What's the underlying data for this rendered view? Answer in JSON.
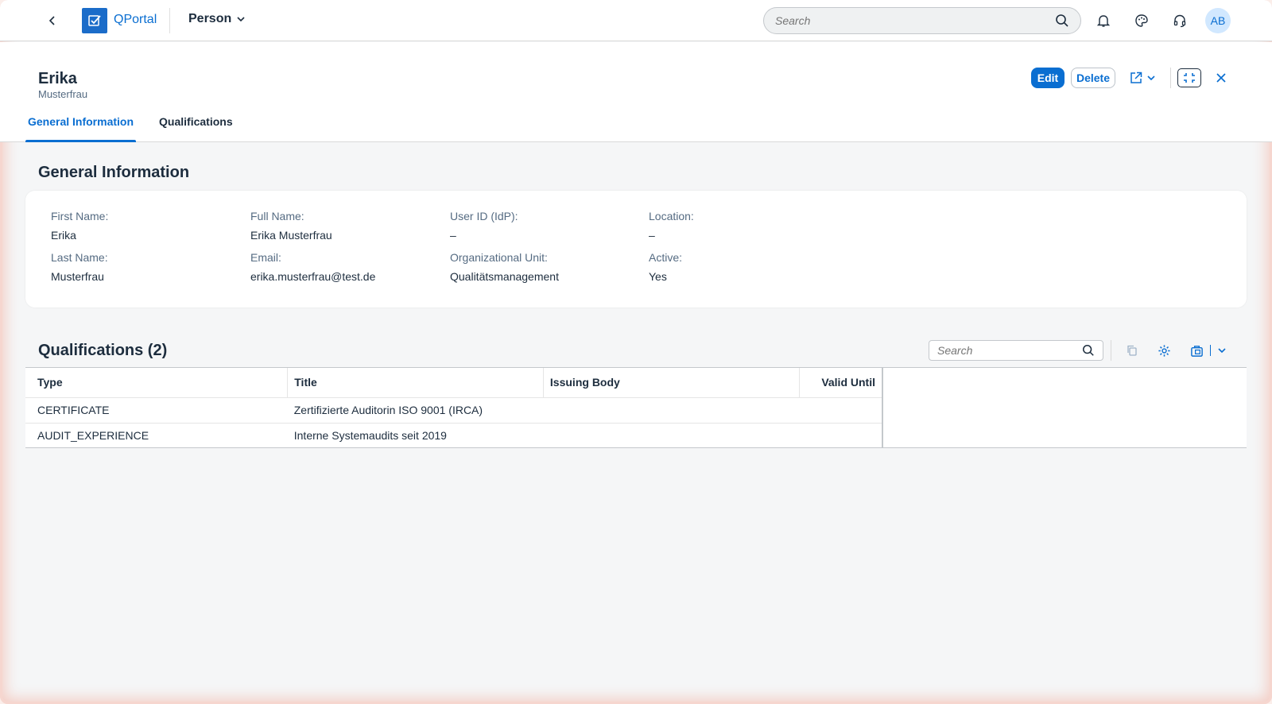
{
  "shell": {
    "app_name": "QPortal",
    "menu_label": "Person",
    "search_placeholder": "Search",
    "avatar_initials": "AB"
  },
  "header": {
    "title": "Erika",
    "subtitle": "Musterfrau",
    "edit_label": "Edit",
    "delete_label": "Delete",
    "tabs": [
      {
        "label": "General Information",
        "active": true
      },
      {
        "label": "Qualifications",
        "active": false
      }
    ]
  },
  "general": {
    "section_title": "General Information",
    "fields": {
      "first_name": {
        "label": "First Name:",
        "value": "Erika"
      },
      "last_name": {
        "label": "Last Name:",
        "value": "Musterfrau"
      },
      "full_name": {
        "label": "Full Name:",
        "value": "Erika Musterfrau"
      },
      "email": {
        "label": "Email:",
        "value": "erika.musterfrau@test.de"
      },
      "user_id": {
        "label": "User ID (IdP):",
        "value": "–"
      },
      "org_unit": {
        "label": "Organizational Unit:",
        "value": "Qualitätsmanagement"
      },
      "location": {
        "label": "Location:",
        "value": "–"
      },
      "active": {
        "label": "Active:",
        "value": "Yes"
      }
    }
  },
  "qualifications": {
    "section_title": "Qualifications (2)",
    "search_placeholder": "Search",
    "columns": [
      "Type",
      "Title",
      "Issuing Body",
      "Valid Until"
    ],
    "rows": [
      [
        "CERTIFICATE",
        "Zertifizierte Auditorin ISO 9001 (IRCA)",
        "",
        ""
      ],
      [
        "AUDIT_EXPERIENCE",
        "Interne Systemaudits seit 2019",
        "",
        ""
      ]
    ]
  },
  "colors": {
    "accent": "#0a6ed1",
    "text": "#1d2d3e",
    "label": "#556b82",
    "background": "#f5f6f7"
  }
}
